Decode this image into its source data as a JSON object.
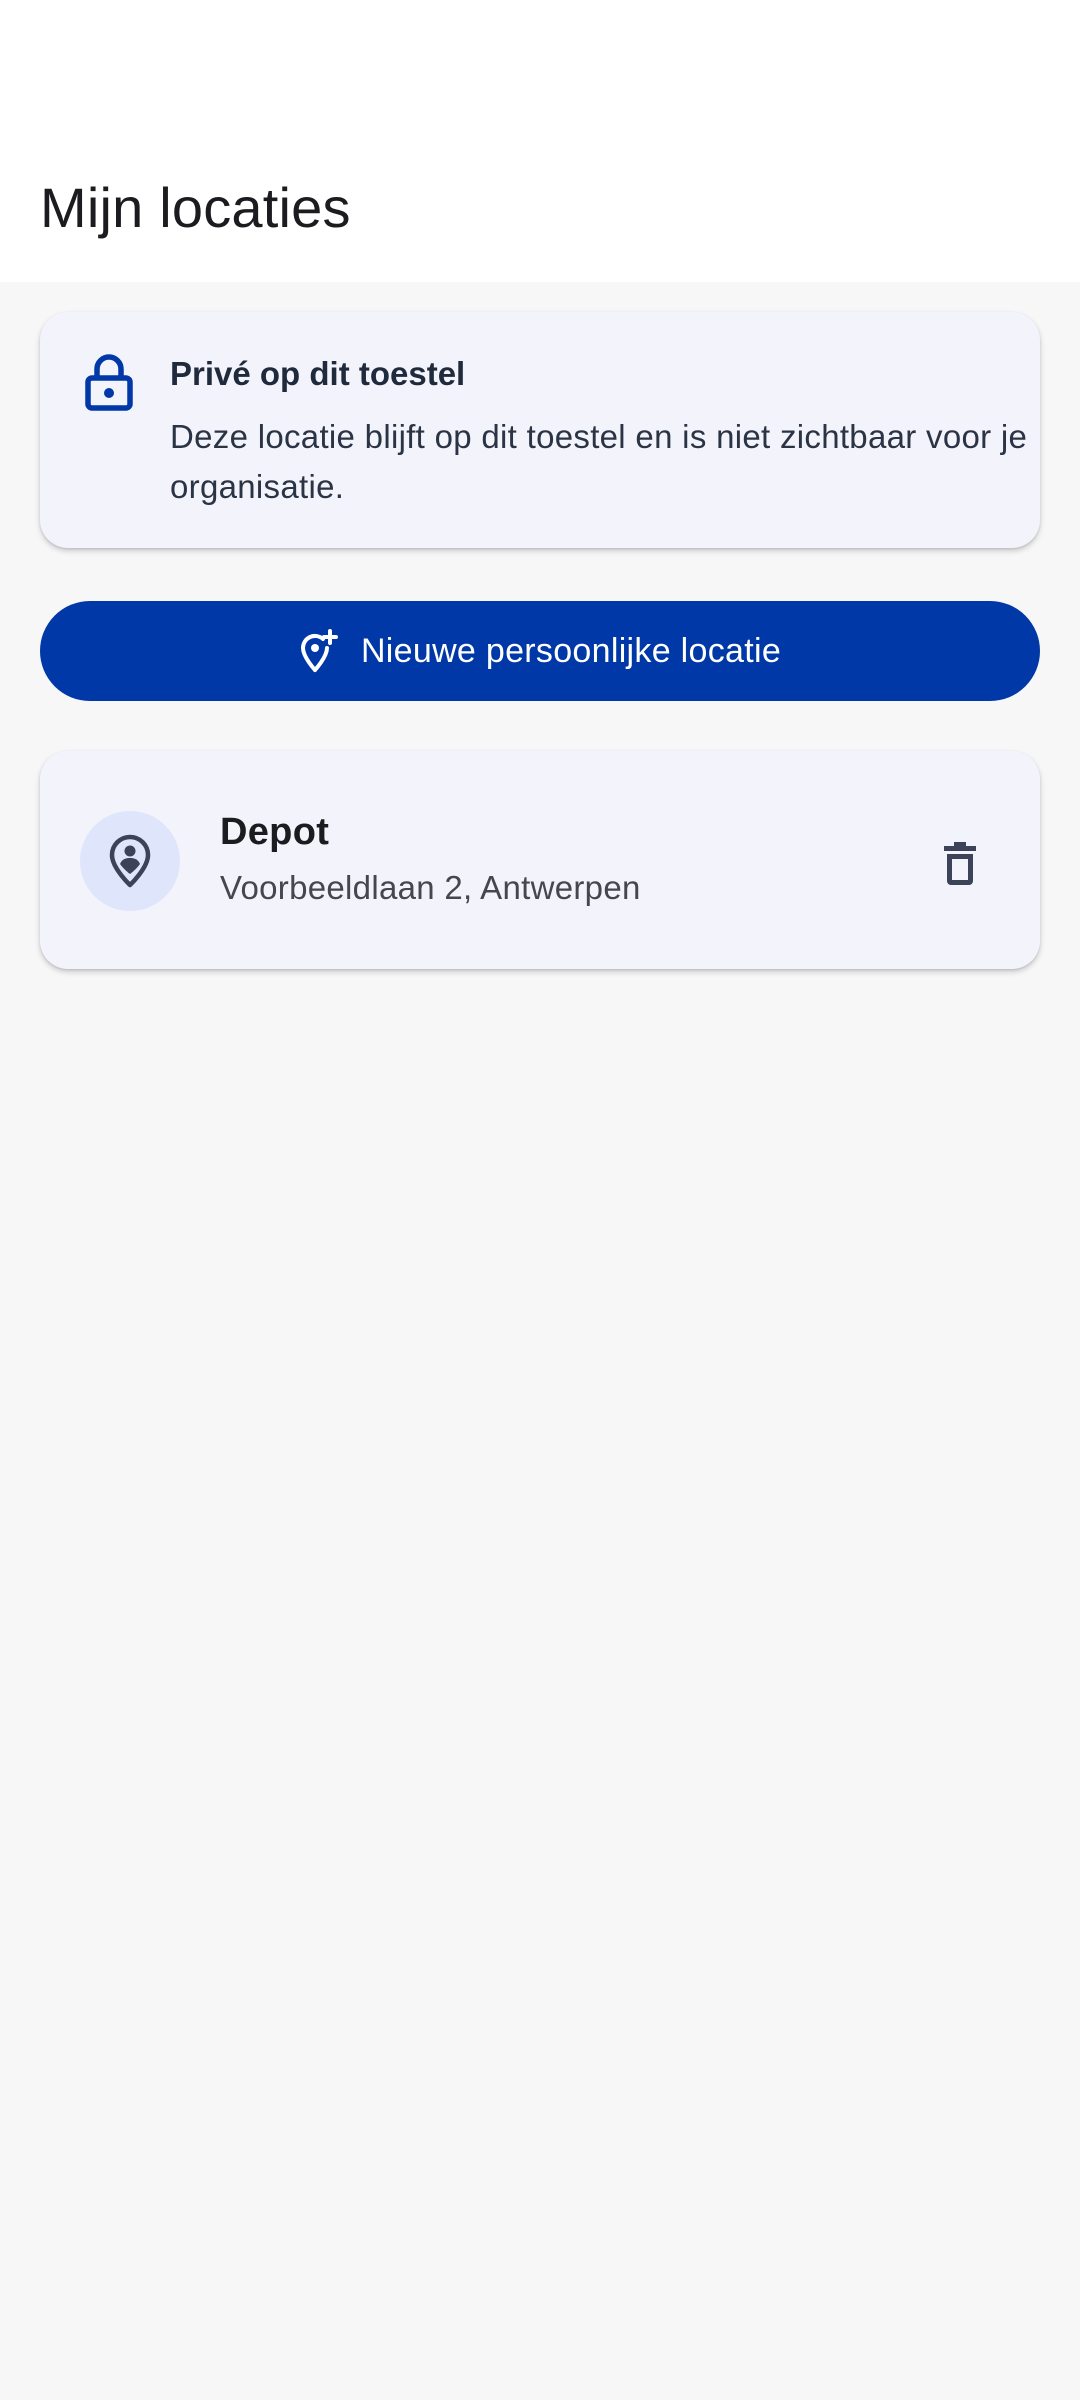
{
  "app_bar": {
    "title": "Mijn locaties"
  },
  "privacy_notice": {
    "icon": "lock-icon",
    "title": "Privé op dit toestel",
    "body": "Deze locatie blijft op dit toestel en is niet zichtbaar voor je organisatie."
  },
  "new_location_button": {
    "icon": "add-location-icon",
    "label": "Nieuwe persoonlijke locatie"
  },
  "locations": [
    {
      "icon": "pin-person-icon",
      "name": "Depot",
      "address": "Voorbeeldlaan 2, Antwerpen",
      "action_icon": "trash-icon"
    }
  ],
  "colors": {
    "primary": "#0038a8",
    "card_background": "#f3f3fb",
    "avatar_background": "#dfe5fb",
    "page_background": "#f7f7f8",
    "app_bar_background": "#ffffff",
    "icon_dark": "#3c4257"
  }
}
